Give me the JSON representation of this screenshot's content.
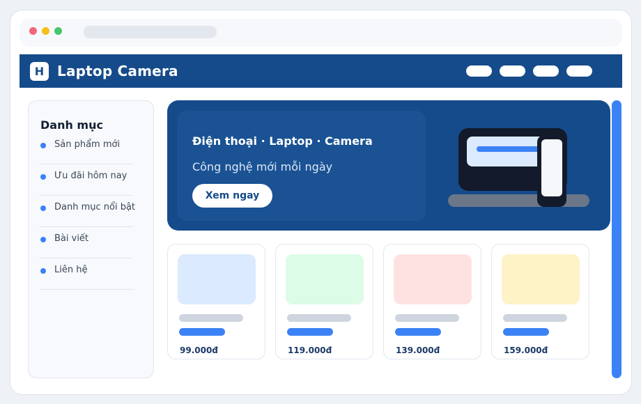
{
  "header": {
    "logo_letter": "H",
    "brand": "Laptop Camera",
    "nav_item_count": 4
  },
  "sidebar": {
    "title": "Danh mục",
    "items": [
      {
        "label": "Sản phẩm mới"
      },
      {
        "label": "Ưu đãi hôm nay"
      },
      {
        "label": "Danh mục nổi bật"
      },
      {
        "label": "Bài viết"
      },
      {
        "label": "Liên hệ"
      }
    ]
  },
  "hero": {
    "title": "Điện thoại · Laptop · Camera",
    "subtitle": "Công nghệ mới mỗi ngày",
    "cta_label": "Xem ngay"
  },
  "products": [
    {
      "price": "99.000đ",
      "thumb_color": "#dbeafe"
    },
    {
      "price": "119.000đ",
      "thumb_color": "#dcfce7"
    },
    {
      "price": "139.000đ",
      "thumb_color": "#fee2e2"
    },
    {
      "price": "159.000đ",
      "thumb_color": "#fef3c7"
    }
  ],
  "colors": {
    "brand_primary": "#154b8a",
    "accent": "#3b82f6",
    "window_close": "#f2667a",
    "window_minimize": "#f3c01c",
    "window_maximize": "#45c76c"
  },
  "icons": {
    "logo": "brand-logo-icon",
    "hero_art": "laptop-phone-illustration-icon"
  }
}
